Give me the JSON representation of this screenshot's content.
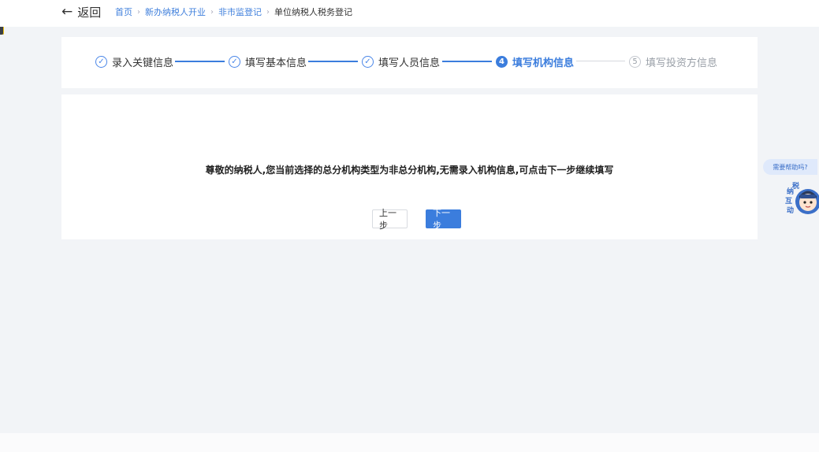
{
  "header": {
    "back_label": "返回",
    "back_icon": "arrow-left-icon",
    "breadcrumb": {
      "links": [
        "首页",
        "新办纳税人开业",
        "非市监登记"
      ],
      "current": "单位纳税人税务登记"
    }
  },
  "steps": [
    {
      "label": "录入关键信息",
      "status": "done",
      "marker": "✓"
    },
    {
      "label": "填写基本信息",
      "status": "done",
      "marker": "✓"
    },
    {
      "label": "填写人员信息",
      "status": "done",
      "marker": "✓"
    },
    {
      "label": "填写机构信息",
      "status": "active",
      "marker": "4"
    },
    {
      "label": "填写投资方信息",
      "status": "pending",
      "marker": "5"
    }
  ],
  "main": {
    "notice": "尊敬的纳税人,您当前选择的总分机构类型为非总分机构,无需录入机构信息,可点击下一步继续填写",
    "prev_label": "上一步",
    "next_label": "下一步"
  },
  "help": {
    "bubble": "需要帮助吗?",
    "assistant_text": "纳税互动",
    "assistant_icon": "assistant-avatar-icon"
  },
  "colors": {
    "accent": "#3b7ddd",
    "link": "#3f7fdc",
    "background": "#f2f4f7"
  }
}
